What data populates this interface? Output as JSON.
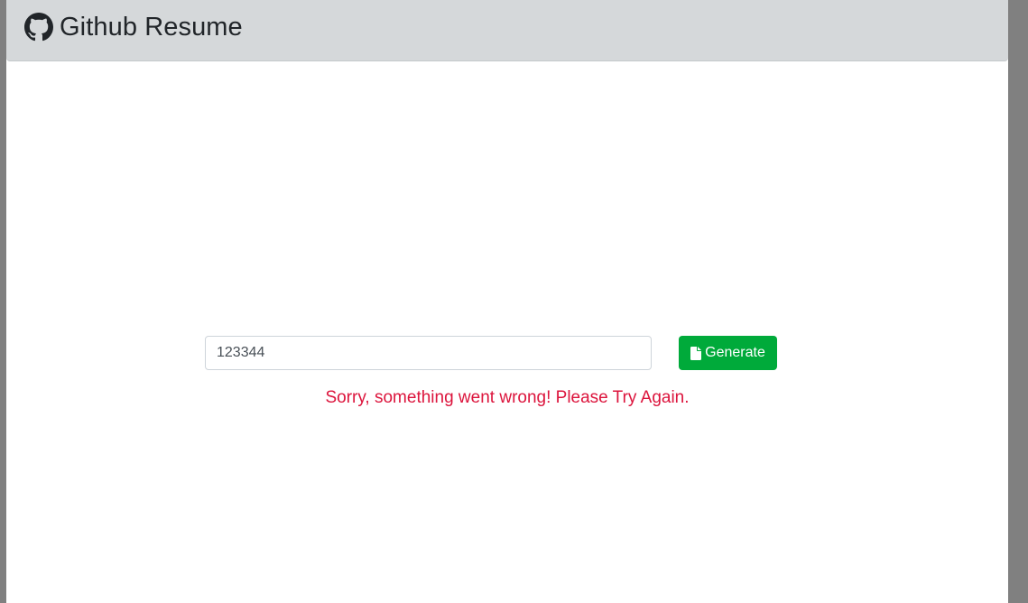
{
  "navbar": {
    "brand_icon": "github-icon",
    "title": "Github Resume"
  },
  "form": {
    "username_value": "123344",
    "generate_icon": "file-icon",
    "generate_label": "Generate"
  },
  "error": {
    "message": "Sorry, something went wrong! Please Try Again."
  },
  "colors": {
    "navbar_bg": "#d5d8da",
    "button_bg": "#00aa3a",
    "error_text": "#dc143c",
    "outer_bg": "#808080"
  }
}
